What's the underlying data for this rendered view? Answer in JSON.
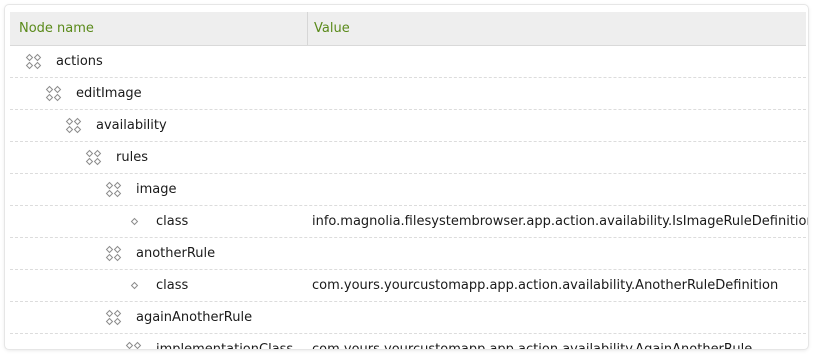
{
  "table": {
    "columns": {
      "name": "Node name",
      "value": "Value"
    },
    "rows": [
      {
        "name": "actions",
        "value": "",
        "type": "node",
        "depth": 0
      },
      {
        "name": "editImage",
        "value": "",
        "type": "node",
        "depth": 1
      },
      {
        "name": "availability",
        "value": "",
        "type": "node",
        "depth": 2
      },
      {
        "name": "rules",
        "value": "",
        "type": "node",
        "depth": 3
      },
      {
        "name": "image",
        "value": "",
        "type": "node",
        "depth": 4
      },
      {
        "name": "class",
        "value": "info.magnolia.filesystembrowser.app.action.availability.IsImageRuleDefinition",
        "type": "property",
        "depth": 5
      },
      {
        "name": "anotherRule",
        "value": "",
        "type": "node",
        "depth": 4
      },
      {
        "name": "class",
        "value": "com.yours.yourcustomapp.app.action.availability.AnotherRuleDefinition",
        "type": "property",
        "depth": 5
      },
      {
        "name": "againAnotherRule",
        "value": "",
        "type": "node",
        "depth": 4
      },
      {
        "name": "implementationClass",
        "value": "com.yours.yourcustomapp.app.action.availability.AgainAnotherRule",
        "type": "node",
        "depth": 5
      }
    ]
  },
  "icons": {
    "node": "node-icon",
    "property": "property-icon"
  },
  "colors": {
    "header_text": "#5a8a1a",
    "header_bg": "#eeeeee",
    "icon_stroke": "#8c8c8c"
  }
}
